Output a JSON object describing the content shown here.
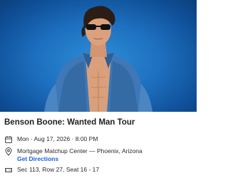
{
  "event": {
    "title": "Benson Boone: Wanted Man Tour",
    "datetime": "Mon · Aug 17, 2026 · 8:00 PM",
    "venue": "Mortgage Matchup Center — Phoenix, Arizona",
    "directions_label": "Get Directions",
    "seats": "Sec 113, Row 27, Seat 16 - 17"
  },
  "icons": {
    "date": "calendar-icon",
    "venue": "location-pin-icon",
    "seats": "ticket-icon"
  },
  "colors": {
    "hero_background": "#1d6fbf",
    "link": "#1a5fd6",
    "title_text": "#1f1f1f",
    "body_text": "#2a2a2a"
  }
}
